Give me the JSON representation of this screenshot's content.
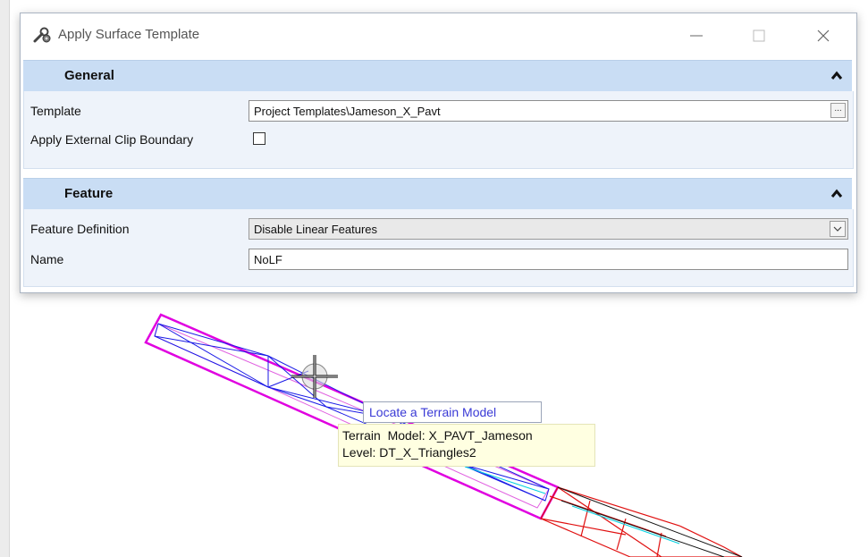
{
  "window": {
    "title": "Apply Surface Template",
    "app_icon": "tool-wrench-icon",
    "controls": [
      "minimize-icon",
      "maximize-icon",
      "close-icon"
    ]
  },
  "sections": {
    "general": {
      "label": "General",
      "template_label": "Template",
      "template_value": "Project Templates\\Jameson_X_Pavt",
      "browse_button": "...",
      "clip_label": "Apply External Clip Boundary",
      "clip_checked": false
    },
    "feature": {
      "label": "Feature",
      "definition_label": "Feature Definition",
      "definition_value": "Disable Linear Features",
      "name_label": "Name",
      "name_value": "NoLF"
    }
  },
  "tooltips": {
    "locate": "Locate a Terrain Model",
    "terrain_model": "Terrain  Model: X_PAVT_Jameson",
    "level": "Level: DT_X_Triangles2"
  },
  "colors": {
    "section_header": "#c9ddf4",
    "section_body": "#eef3fa",
    "terrain_outline": "#e000e0",
    "triangles": "#1a1ae6",
    "red_model": "#e01010",
    "tooltip_bg": "#ffffe1",
    "locate_text": "#3a3ad6"
  }
}
